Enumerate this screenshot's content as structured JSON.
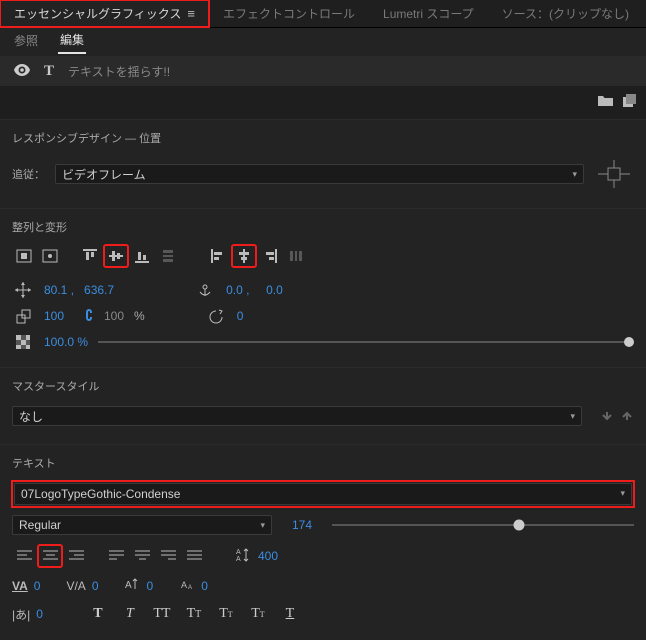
{
  "panel": {
    "tabs": [
      "エッセンシャルグラフィックス",
      "エフェクトコントロール",
      "Lumetri スコープ",
      "ソース：(クリップなし)"
    ]
  },
  "subtabs": {
    "browse": "参照",
    "edit": "編集"
  },
  "layer": {
    "text": "テキストを揺らす!!"
  },
  "responsive": {
    "title": "レスポンシブデザイン ― 位置",
    "pin_label": "追従：",
    "pin_value": "ビデオフレーム"
  },
  "align": {
    "title": "整列と変形",
    "pos": {
      "x": "80.1 ,",
      "y": "636.7"
    },
    "anchor": {
      "x": "0.0 ,",
      "y": "0.0"
    },
    "scale": {
      "v": "100",
      "link": "100",
      "pct": "%"
    },
    "rotation": "0",
    "opacity": "100.0 %"
  },
  "master": {
    "title": "マスタースタイル",
    "value": "なし"
  },
  "text": {
    "title": "テキスト",
    "font": "07LogoTypeGothic-Condense",
    "style": "Regular",
    "size": "174",
    "leading": "400",
    "tracking": "0",
    "kerning": "0",
    "baseline": "0",
    "tsume": "0",
    "tatechuyoko": "0"
  }
}
